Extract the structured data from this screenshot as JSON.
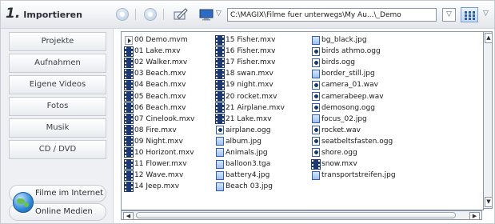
{
  "toolbar": {
    "step_number": "1.",
    "title": "Importieren",
    "path": "C:\\MAGIX\\Filme fuer unterwegs\\My Au...\\_Demo",
    "path_dropdown": "▽",
    "view_dropdown": "▽",
    "monitor_dropdown": "▽"
  },
  "sidebar": {
    "items": [
      {
        "label": "Projekte"
      },
      {
        "label": "Aufnahmen"
      },
      {
        "label": "Eigene Videos"
      },
      {
        "label": "Fotos"
      },
      {
        "label": "Musik"
      },
      {
        "label": "CD / DVD"
      }
    ],
    "online": {
      "internet_label": "Filme im Internet",
      "media_label": "Online Medien",
      "icon": "globe-icon"
    }
  },
  "files": {
    "columns": [
      [
        {
          "name": "00 Demo.mvm",
          "type": "other"
        },
        {
          "name": "01 Lake.mxv",
          "type": "video"
        },
        {
          "name": "02 Walker.mxv",
          "type": "video"
        },
        {
          "name": "03 Beach.mxv",
          "type": "video"
        },
        {
          "name": "04 Beach.mxv",
          "type": "video"
        },
        {
          "name": "05 Beach.mxv",
          "type": "video"
        },
        {
          "name": "06 Beach.mxv",
          "type": "video"
        },
        {
          "name": "07 Cinelook.mxv",
          "type": "video"
        },
        {
          "name": "08 Fire.mxv",
          "type": "video"
        },
        {
          "name": "09 Night.mxv",
          "type": "video"
        },
        {
          "name": "10 Horizont.mxv",
          "type": "video"
        },
        {
          "name": "11 Flower.mxv",
          "type": "video"
        },
        {
          "name": "12 Wave.mxv",
          "type": "video"
        },
        {
          "name": "14 Jeep.mxv",
          "type": "video"
        }
      ],
      [
        {
          "name": "15 Fisher.mxv",
          "type": "video"
        },
        {
          "name": "16 Fisher.mxv",
          "type": "video"
        },
        {
          "name": "17 Fisher.mxv",
          "type": "video"
        },
        {
          "name": "18 swan.mxv",
          "type": "video"
        },
        {
          "name": "19 night.mxv",
          "type": "video"
        },
        {
          "name": "20 rocket.mxv",
          "type": "video"
        },
        {
          "name": "21 Airplane.mxv",
          "type": "video"
        },
        {
          "name": "21 Lake.mxv",
          "type": "video"
        },
        {
          "name": "airplane.ogg",
          "type": "audio"
        },
        {
          "name": "album.jpg",
          "type": "image"
        },
        {
          "name": "Animals.jpg",
          "type": "image"
        },
        {
          "name": "balloon3.tga",
          "type": "image"
        },
        {
          "name": "battery4.jpg",
          "type": "image"
        },
        {
          "name": "Beach 03.jpg",
          "type": "image"
        }
      ],
      [
        {
          "name": "bg_black.jpg",
          "type": "image"
        },
        {
          "name": "birds athmo.ogg",
          "type": "audio"
        },
        {
          "name": "birds.ogg",
          "type": "audio"
        },
        {
          "name": "border_still.jpg",
          "type": "image"
        },
        {
          "name": "camera_01.wav",
          "type": "audio"
        },
        {
          "name": "camerabeep.wav",
          "type": "audio"
        },
        {
          "name": "demosong.ogg",
          "type": "audio"
        },
        {
          "name": "focus_02.jpg",
          "type": "image"
        },
        {
          "name": "rocket.wav",
          "type": "audio"
        },
        {
          "name": "seatbeltsfasten.ogg",
          "type": "audio"
        },
        {
          "name": "shore.ogg",
          "type": "audio"
        },
        {
          "name": "snow.mxv",
          "type": "video"
        },
        {
          "name": "transportstreifen.jpg",
          "type": "image"
        }
      ]
    ]
  },
  "colors": {
    "accent": "#2d5fb0",
    "video_icon": "#1d3970"
  }
}
